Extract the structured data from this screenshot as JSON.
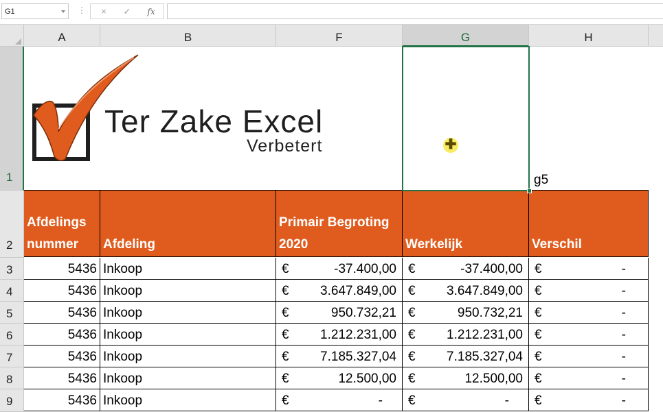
{
  "formula_bar": {
    "name_box": "G1",
    "dots": "⋮",
    "cancel_icon": "×",
    "enter_icon": "✓",
    "fx_label": "fx",
    "formula": ""
  },
  "columns": [
    "A",
    "B",
    "F",
    "G",
    "H"
  ],
  "selected_column": "G",
  "rows": [
    "1",
    "2",
    "3",
    "4",
    "5",
    "6",
    "7",
    "8",
    "9"
  ],
  "selected_row": "1",
  "logo": {
    "title": "Ter Zake Excel",
    "tagline": "Verbetert",
    "accent_color": "#e05c1e"
  },
  "h1_text": "g5",
  "header": {
    "a": [
      "Afdelings",
      "nummer"
    ],
    "b": "Afdeling",
    "f": [
      "Primair Begroting",
      "2020"
    ],
    "g": "Werkelijk",
    "h": "Verschil",
    "fill_color": "#e05c1e"
  },
  "table": [
    {
      "nummer": "5436",
      "afdeling": "Inkoop",
      "eur_f": "€",
      "begroting": "-37.400,00",
      "eur_g": "€",
      "werkelijk": "-37.400,00",
      "eur_h": "€",
      "verschil": "-"
    },
    {
      "nummer": "5436",
      "afdeling": "Inkoop",
      "eur_f": "€",
      "begroting": "3.647.849,00",
      "eur_g": "€",
      "werkelijk": "3.647.849,00",
      "eur_h": "€",
      "verschil": "-"
    },
    {
      "nummer": "5436",
      "afdeling": "Inkoop",
      "eur_f": "€",
      "begroting": "950.732,21",
      "eur_g": "€",
      "werkelijk": "950.732,21",
      "eur_h": "€",
      "verschil": "-"
    },
    {
      "nummer": "5436",
      "afdeling": "Inkoop",
      "eur_f": "€",
      "begroting": "1.212.231,00",
      "eur_g": "€",
      "werkelijk": "1.212.231,00",
      "eur_h": "€",
      "verschil": "-"
    },
    {
      "nummer": "5436",
      "afdeling": "Inkoop",
      "eur_f": "€",
      "begroting": "7.185.327,04",
      "eur_g": "€",
      "werkelijk": "7.185.327,04",
      "eur_h": "€",
      "verschil": "-"
    },
    {
      "nummer": "5436",
      "afdeling": "Inkoop",
      "eur_f": "€",
      "begroting": "12.500,00",
      "eur_g": "€",
      "werkelijk": "12.500,00",
      "eur_h": "€",
      "verschil": "-"
    },
    {
      "nummer": "5436",
      "afdeling": "Inkoop",
      "eur_f": "€",
      "begroting": "-",
      "eur_g": "€",
      "werkelijk": "-",
      "eur_h": "€",
      "verschil": "-"
    }
  ]
}
